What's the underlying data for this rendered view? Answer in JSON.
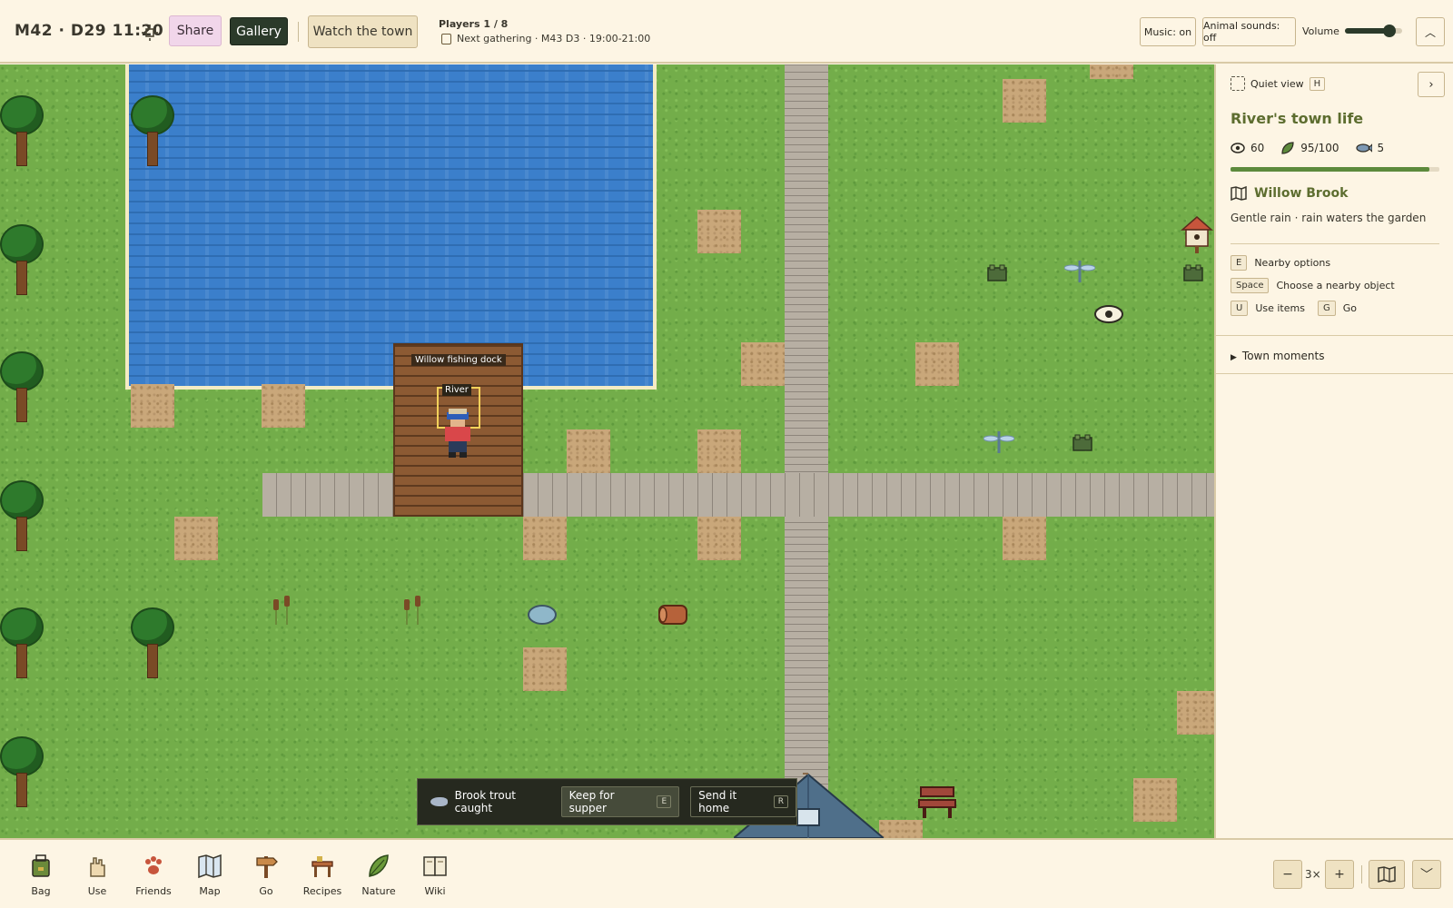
{
  "topbar": {
    "clock": "M42 · D29 11:20",
    "share_label": "Share",
    "gallery_label": "Gallery",
    "watch_label": "Watch the town",
    "players": "Players 1 / 8",
    "next_gathering": "Next gathering · M43 D3 · 19:00-21:00",
    "music_label": "Music: on",
    "animal_sounds_label": "Animal sounds: off",
    "volume_label": "Volume",
    "volume_level": 0.78
  },
  "map": {
    "dock_label": "Willow fishing dock",
    "player_name": "River"
  },
  "notification": {
    "text": "Brook trout caught",
    "keep_label": "Keep for supper",
    "keep_key": "E",
    "send_label": "Send it home",
    "send_key": "R"
  },
  "panel": {
    "quiet_label": "Quiet view",
    "quiet_key": "H",
    "title": "River's town life",
    "stat_vision": "60",
    "stat_energy": "95/100",
    "stat_fish": "5",
    "energy_fraction": 0.95,
    "location": "Willow Brook",
    "weather": "Gentle rain · rain waters the garden",
    "keys": [
      {
        "key": "E",
        "label": "Nearby options"
      },
      {
        "key": "Space",
        "label": "Choose a nearby object"
      },
      {
        "key": "U",
        "label": "Use items"
      },
      {
        "key": "G",
        "label": "Go"
      }
    ],
    "moments_label": "Town moments"
  },
  "toolbar": {
    "items": [
      "Bag",
      "Use",
      "Friends",
      "Map",
      "Go",
      "Recipes",
      "Nature",
      "Wiki"
    ]
  },
  "zoom": {
    "minus": "−",
    "value": "3×",
    "plus": "+"
  },
  "colors": {
    "grass": "#73ad4a",
    "water": "#3b7fcb",
    "accent_green": "#5d6d2f",
    "dark_button": "#2b3a2a",
    "share_pink": "#f1d6ea"
  }
}
